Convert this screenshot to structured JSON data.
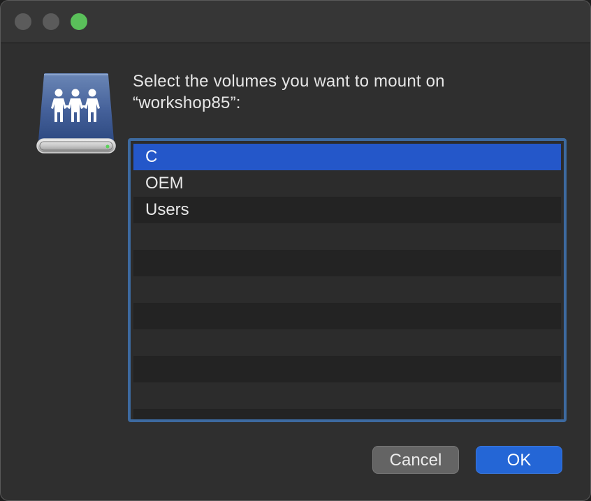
{
  "window": {
    "traffic_lights": [
      {
        "name": "close",
        "color": "#5b5b5b"
      },
      {
        "name": "minimize",
        "color": "#5b5b5b"
      },
      {
        "name": "zoom",
        "color": "#5ac05a"
      }
    ]
  },
  "dialog": {
    "icon": "network-server-drive-icon",
    "prompt": "Select the volumes you want to mount on “workshop85”:",
    "volumes": [
      {
        "label": "C",
        "selected": true
      },
      {
        "label": "OEM",
        "selected": false
      },
      {
        "label": "Users",
        "selected": false
      }
    ],
    "cancel_label": "Cancel",
    "ok_label": "OK"
  },
  "colors": {
    "selection": "#2457c9",
    "default_button": "#2466d6",
    "list_focus_ring": "#3d6aa0"
  }
}
